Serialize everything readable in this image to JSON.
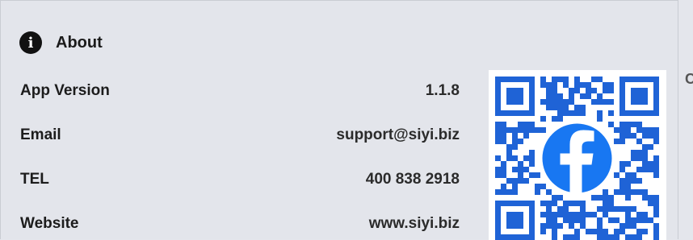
{
  "about": {
    "title": "About",
    "icon": "info-icon",
    "rows": [
      {
        "label": "App Version",
        "value": "1.1.8"
      },
      {
        "label": "Email",
        "value": "support@siyi.biz"
      },
      {
        "label": "TEL",
        "value": "400 838 2918"
      },
      {
        "label": "Website",
        "value": "www.siyi.biz"
      }
    ],
    "qr_code": {
      "icon": "facebook-qr-code",
      "brand_color": "#1877f2",
      "module_color": "#1f63d6"
    }
  },
  "edge_text": "C"
}
